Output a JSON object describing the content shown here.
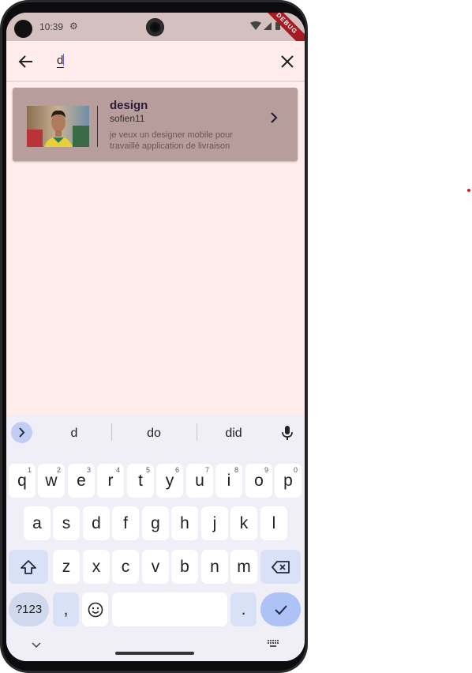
{
  "status_bar": {
    "time": "10:39",
    "debug_label": "DEBUG"
  },
  "search": {
    "query": "d"
  },
  "results": [
    {
      "title": "design",
      "user": "sofien11",
      "description": "je veux un designer mobile pour travaillé application de livraison"
    }
  ],
  "keyboard": {
    "suggestions": [
      "d",
      "do",
      "did"
    ],
    "row1": [
      {
        "key": "q",
        "hint": "1"
      },
      {
        "key": "w",
        "hint": "2"
      },
      {
        "key": "e",
        "hint": "3"
      },
      {
        "key": "r",
        "hint": "4"
      },
      {
        "key": "t",
        "hint": "5"
      },
      {
        "key": "y",
        "hint": "6"
      },
      {
        "key": "u",
        "hint": "7"
      },
      {
        "key": "i",
        "hint": "8"
      },
      {
        "key": "o",
        "hint": "9"
      },
      {
        "key": "p",
        "hint": "0"
      }
    ],
    "row2": [
      "a",
      "s",
      "d",
      "f",
      "g",
      "h",
      "j",
      "k",
      "l"
    ],
    "row3": [
      "z",
      "x",
      "c",
      "v",
      "b",
      "n",
      "m"
    ],
    "symbols_label": "?123",
    "comma_label": ",",
    "period_label": "."
  },
  "colors": {
    "screen_bg": "#ffeceb",
    "card_bg": "#b79d9c",
    "keyboard_bg": "#f0eef6",
    "accent": "#aec2f5"
  }
}
